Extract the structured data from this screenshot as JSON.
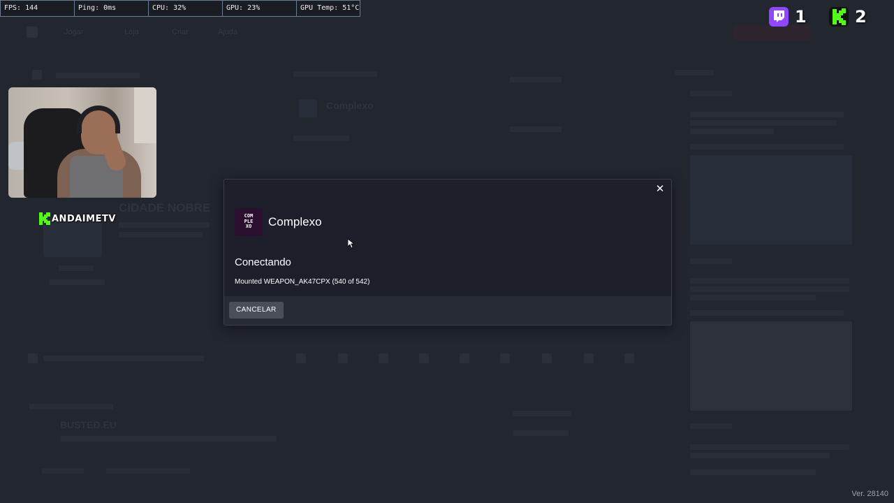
{
  "perf_overlay": {
    "fps": "FPS: 144",
    "ping": "Ping: 0ms",
    "cpu": "CPU: 32%",
    "gpu": "GPU: 23%",
    "gpu_temp": "GPU Temp: 51°C"
  },
  "social": {
    "twitch_count": "1",
    "kick_count": "2",
    "twitch_color": "#9146ff",
    "kick_color": "#53fc18"
  },
  "streamer": {
    "name": "ANDAIMETV",
    "name_prefix_icon": "kick-logo-icon"
  },
  "modal": {
    "server_name": "Complexo",
    "server_icon_text": "COM PLE XO",
    "status_title": "Conectando",
    "status_detail": "Mounted WEAPON_AK47CPX (540 of 542)",
    "cancel_label": "CANCELAR",
    "close_icon": "close-icon"
  },
  "background_app": {
    "nav_items": [
      "Jogar",
      "Loja",
      "Criar",
      "Ajuda"
    ],
    "headings": [
      "CIDADE NOBRE",
      "Complexo",
      "BUSTED.EU"
    ]
  },
  "version": "Ver. 28140"
}
